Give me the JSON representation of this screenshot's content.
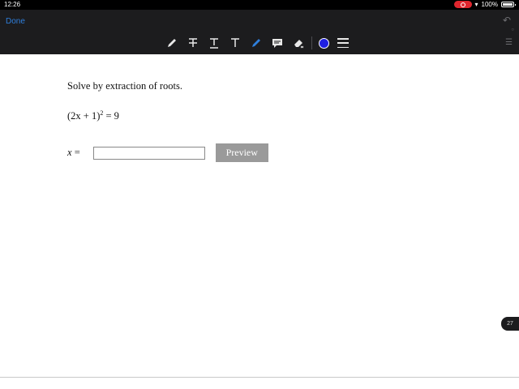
{
  "status_bar": {
    "time": "12:26",
    "battery_text": "100%",
    "record_color": "#e0262e"
  },
  "toolbar": {
    "done_label": "Done",
    "tools": [
      {
        "icon": "pen-icon"
      },
      {
        "icon": "strikethrough-text-icon"
      },
      {
        "icon": "underline-text-icon"
      },
      {
        "icon": "text-icon"
      },
      {
        "icon": "highlighter-icon"
      },
      {
        "icon": "comment-icon"
      },
      {
        "icon": "eraser-icon"
      }
    ],
    "selected_color": "#1f1fe0",
    "accent_color": "#2f7fdc"
  },
  "problem": {
    "prompt": "Solve by extraction of roots.",
    "equation_left": "(2x + 1)",
    "equation_exponent": "2",
    "equation_right": "= 9",
    "answer_variable": "x",
    "answer_equals": "=",
    "answer_value": "",
    "preview_label": "Preview"
  },
  "page_badge": "27"
}
